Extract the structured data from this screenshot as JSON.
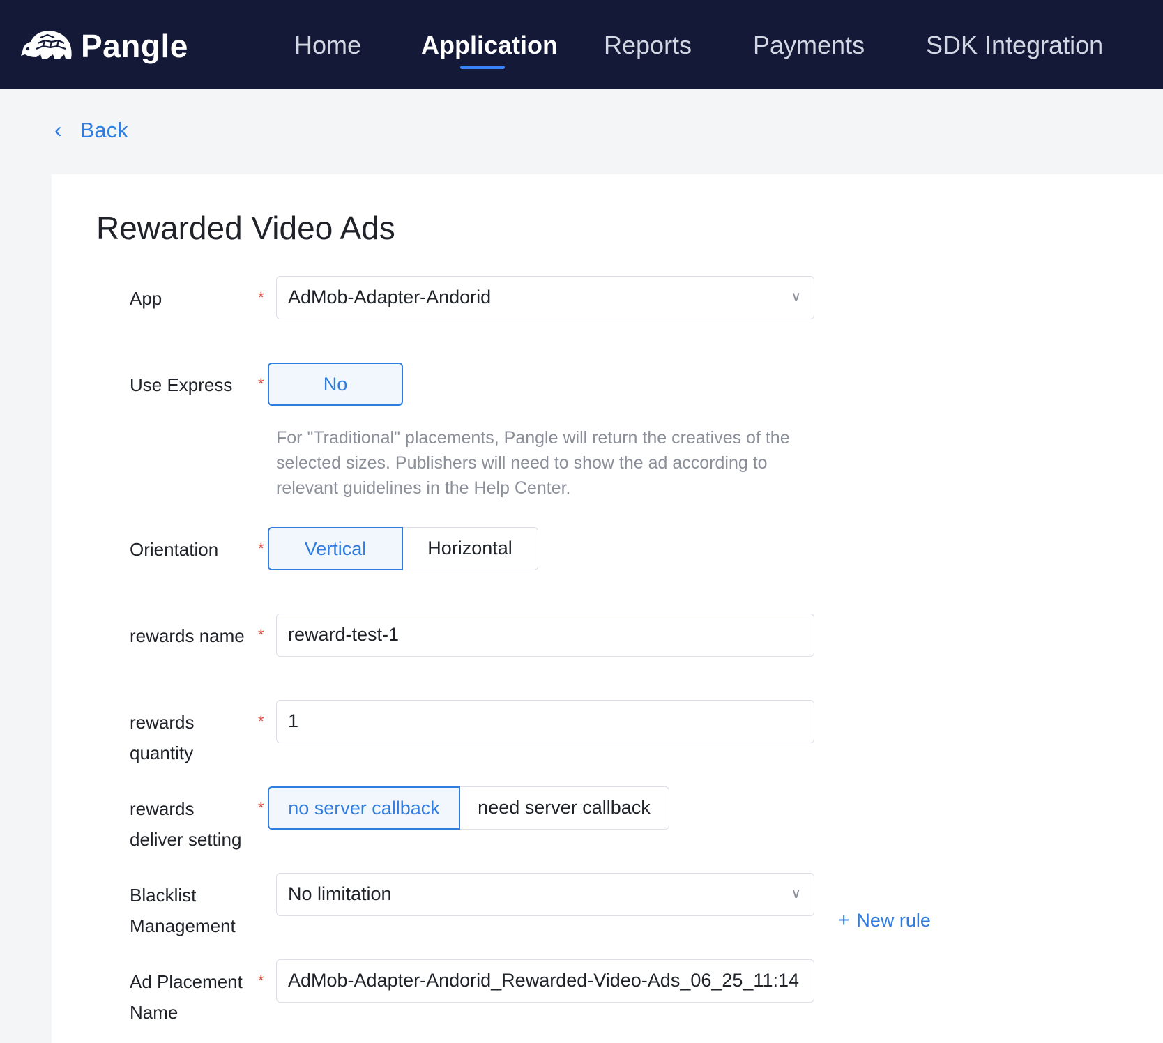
{
  "brand": {
    "name": "Pangle",
    "logo_icon": "pangolin-logo-icon"
  },
  "nav": {
    "items": [
      {
        "label": "Home",
        "active": false
      },
      {
        "label": "Application",
        "active": true
      },
      {
        "label": "Reports",
        "active": false
      },
      {
        "label": "Payments",
        "active": false
      },
      {
        "label": "SDK Integration",
        "active": false
      }
    ]
  },
  "back": {
    "label": "Back"
  },
  "page": {
    "title": "Rewarded Video Ads"
  },
  "form": {
    "required_mark": "*",
    "app": {
      "label": "App",
      "value": "AdMob-Adapter-Andorid"
    },
    "use_express": {
      "label": "Use Express",
      "option": "No",
      "help": "For \"Traditional\" placements, Pangle will return the creatives of the selected sizes. Publishers will need to show the ad according to relevant guidelines in the Help Center."
    },
    "orientation": {
      "label": "Orientation",
      "options": [
        "Vertical",
        "Horizontal"
      ],
      "selected": "Vertical"
    },
    "rewards_name": {
      "label": "rewards name",
      "value": "reward-test-1"
    },
    "rewards_quantity": {
      "label_line1": "rewards",
      "label_line2": "quantity",
      "value": "1"
    },
    "rewards_deliver": {
      "label_line1": "rewards",
      "label_line2": "deliver setting",
      "options": [
        "no server callback",
        "need server callback"
      ],
      "selected": "no server callback"
    },
    "blacklist": {
      "label_line1": "Blacklist",
      "label_line2": "Management",
      "value": "No limitation",
      "new_rule": "New rule"
    },
    "placement_name": {
      "label_line1": "Ad Placement",
      "label_line2": "Name",
      "value": "AdMob-Adapter-Andorid_Rewarded-Video-Ads_06_25_11:14"
    }
  },
  "colors": {
    "nav_bg": "#131936",
    "accent": "#2f7de1",
    "required": "#e5483d"
  }
}
